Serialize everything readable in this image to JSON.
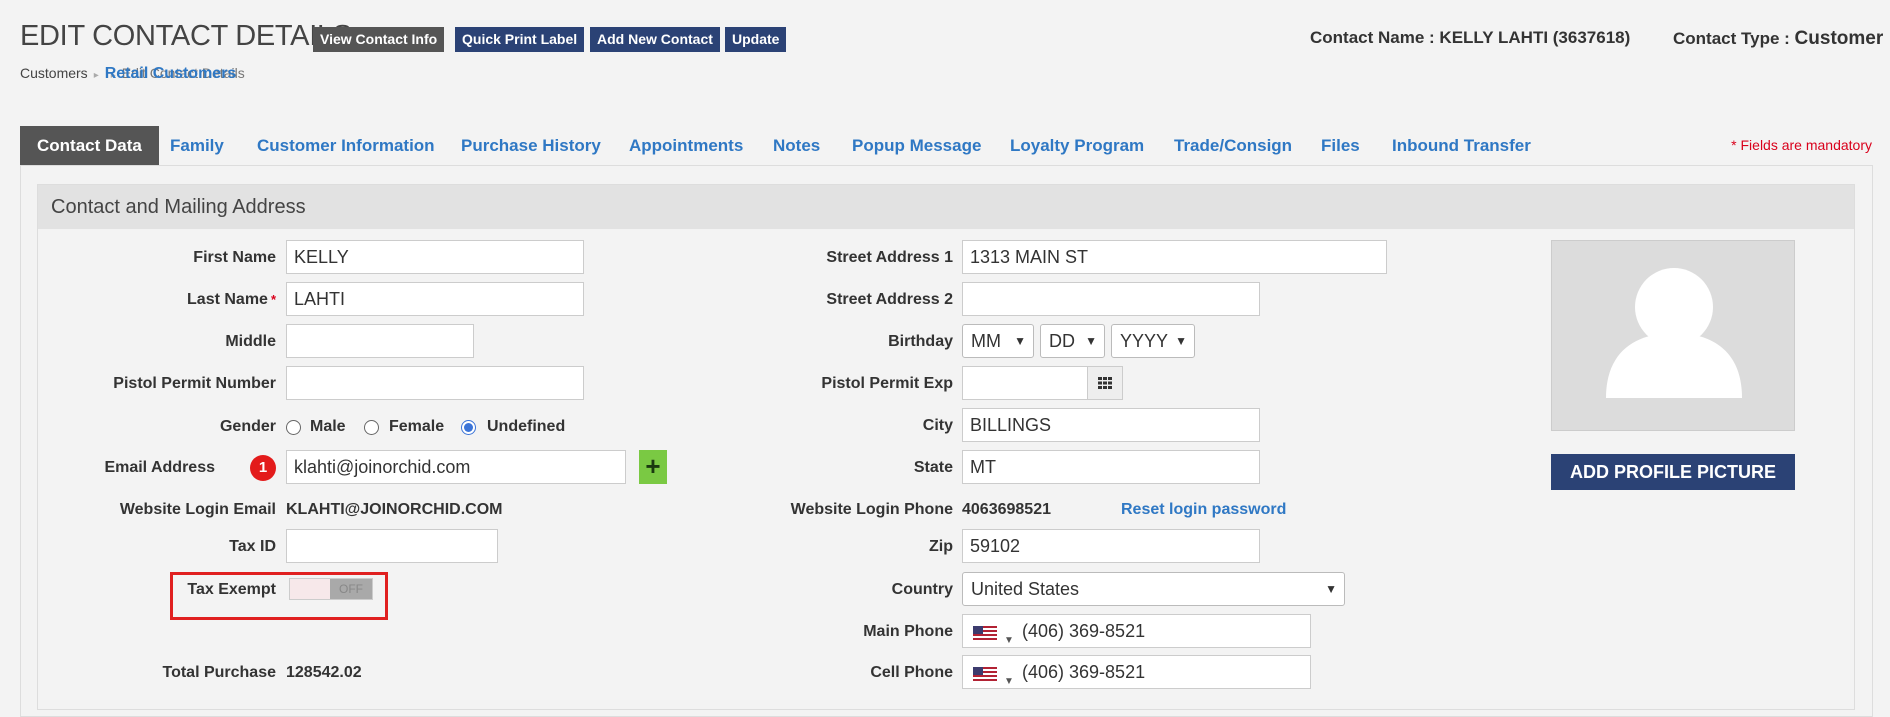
{
  "header": {
    "title": "EDIT CONTACT DETAILS",
    "buttons": {
      "view_contact": "View Contact Info",
      "quick_print": "Quick Print Label",
      "add_new": "Add New Contact",
      "update": "Update"
    },
    "contact_name_label": "Contact Name :",
    "contact_name_value": "KELLY LAHTI (3637618)",
    "contact_type_label": "Contact Type :",
    "contact_type_value": "Customer"
  },
  "breadcrumb": [
    "Customers",
    "Retail Customers",
    "Edit Contact Details"
  ],
  "tabs": [
    "Contact Data",
    "Family",
    "Customer Information",
    "Purchase History",
    "Appointments",
    "Notes",
    "Popup Message",
    "Loyalty Program",
    "Trade/Consign",
    "Files",
    "Inbound Transfer"
  ],
  "mandatory_note": "* Fields are mandatory",
  "section_title": "Contact and Mailing Address",
  "left": {
    "first_name": {
      "label": "First Name",
      "value": "KELLY"
    },
    "last_name": {
      "label": "Last Name",
      "value": "LAHTI",
      "required": "*"
    },
    "middle": {
      "label": "Middle",
      "value": ""
    },
    "pistol_permit": {
      "label": "Pistol Permit Number",
      "value": ""
    },
    "gender": {
      "label": "Gender",
      "options": [
        "Male",
        "Female",
        "Undefined"
      ],
      "selected": "Undefined"
    },
    "email": {
      "label": "Email Address",
      "badge": "1",
      "value": "klahti@joinorchid.com",
      "add_button": "+"
    },
    "website_login_email": {
      "label": "Website Login Email",
      "value": "KLAHTI@JOINORCHID.COM"
    },
    "tax_id": {
      "label": "Tax ID",
      "value": ""
    },
    "tax_exempt": {
      "label": "Tax Exempt",
      "state": "OFF"
    },
    "total_purchase": {
      "label": "Total Purchase",
      "value": "128542.02"
    }
  },
  "right": {
    "street1": {
      "label": "Street Address 1",
      "value": "1313 MAIN ST"
    },
    "street2": {
      "label": "Street Address 2",
      "value": ""
    },
    "birthday": {
      "label": "Birthday",
      "month": "MM",
      "day": "DD",
      "year": "YYYY"
    },
    "pistol_permit_exp": {
      "label": "Pistol Permit Exp",
      "value": ""
    },
    "city": {
      "label": "City",
      "value": "BILLINGS"
    },
    "state": {
      "label": "State",
      "value": "MT"
    },
    "website_login_phone": {
      "label": "Website Login Phone",
      "value": "4063698521",
      "reset_link": "Reset login password"
    },
    "zip": {
      "label": "Zip",
      "value": "59102"
    },
    "country": {
      "label": "Country",
      "value": "United States"
    },
    "main_phone": {
      "label": "Main Phone",
      "value": "(406) 369-8521"
    },
    "cell_phone": {
      "label": "Cell Phone",
      "value": "(406) 369-8521"
    }
  },
  "profile": {
    "button": "ADD PROFILE PICTURE"
  },
  "colors": {
    "accent": "#2b4275",
    "link": "#2f78c4",
    "tab_active": "#555555",
    "required": "#d9001b",
    "highlight_box": "#e02020",
    "add_green": "#7ac943"
  },
  "icons": [
    "avatar-placeholder-icon",
    "calendar-grid-icon",
    "us-flag-icon",
    "plus-icon",
    "chevron-down-icon"
  ]
}
